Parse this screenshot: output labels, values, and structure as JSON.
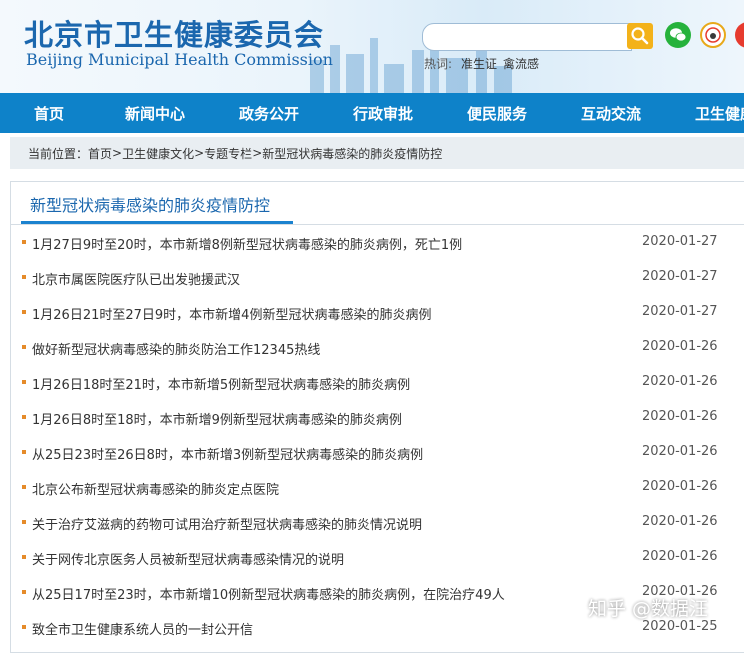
{
  "header": {
    "logo_cn": "北京市卫生健康委员会",
    "logo_en": "Beijing Municipal Health Commission",
    "search": {
      "value": "",
      "placeholder": ""
    },
    "hot_label": "热词:",
    "hot_words": [
      "准生证",
      "禽流感"
    ],
    "social_icons": [
      "wechat-icon",
      "weibo-icon",
      "weibo-icon-2"
    ]
  },
  "nav": {
    "items": [
      "首页",
      "新闻中心",
      "政务公开",
      "行政审批",
      "便民服务",
      "互动交流",
      "卫生健康"
    ]
  },
  "breadcrumb": {
    "prefix": "当前位置：",
    "items": [
      "首页",
      "卫生健康文化",
      "专题专栏",
      "新型冠状病毒感染的肺炎疫情防控"
    ],
    "separator": ">"
  },
  "panel": {
    "title": "新型冠状病毒感染的肺炎疫情防控",
    "news": [
      {
        "title": "1月27日9时至20时，本市新增8例新型冠状病毒感染的肺炎病例，死亡1例",
        "date": "2020-01-27"
      },
      {
        "title": "北京市属医院医疗队已出发驰援武汉",
        "date": "2020-01-27"
      },
      {
        "title": "1月26日21时至27日9时，本市新增4例新型冠状病毒感染的肺炎病例",
        "date": "2020-01-27"
      },
      {
        "title": "做好新型冠状病毒感染的肺炎防治工作12345热线",
        "date": "2020-01-26"
      },
      {
        "title": "1月26日18时至21时，本市新增5例新型冠状病毒感染的肺炎病例",
        "date": "2020-01-26"
      },
      {
        "title": "1月26日8时至18时，本市新增9例新型冠状病毒感染的肺炎病例",
        "date": "2020-01-26"
      },
      {
        "title": "从25日23时至26日8时，本市新增3例新型冠状病毒感染的肺炎病例",
        "date": "2020-01-26"
      },
      {
        "title": "北京公布新型冠状病毒感染的肺炎定点医院",
        "date": "2020-01-26"
      },
      {
        "title": "关于治疗艾滋病的药物可试用治疗新型冠状病毒感染的肺炎情况说明",
        "date": "2020-01-26"
      },
      {
        "title": "关于网传北京医务人员被新型冠状病毒感染情况的说明",
        "date": "2020-01-26"
      },
      {
        "title": "从25日17时至23时，本市新增10例新型冠状病毒感染的肺炎病例，在院治疗49人",
        "date": "2020-01-26"
      },
      {
        "title": "致全市卫生健康系统人员的一封公开信",
        "date": "2020-01-25"
      }
    ]
  },
  "watermark": "知乎 @数据汪",
  "colors": {
    "brand_blue": "#1b67ae",
    "nav_blue": "#0e82c9",
    "search_button": "#f3b21a",
    "bullet_orange": "#e58b2a",
    "breadcrumb_bg": "#e9eef2"
  }
}
